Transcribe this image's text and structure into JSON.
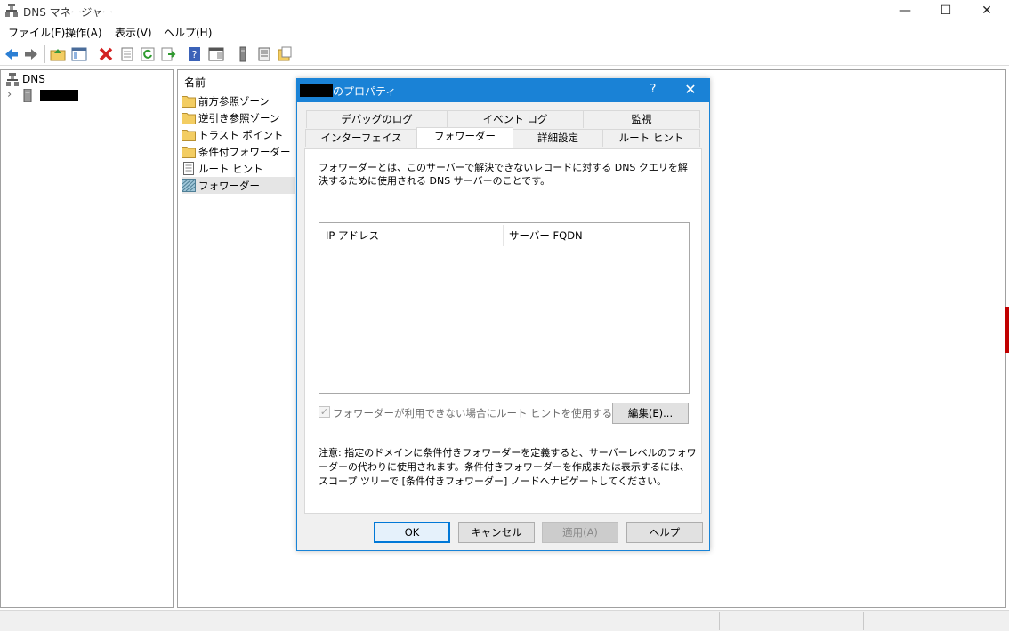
{
  "window": {
    "title": "DNS マネージャー",
    "controls": {
      "minimize": "—",
      "maximize": "☐",
      "close": "✕"
    }
  },
  "menu": {
    "items": [
      {
        "label": "ファイル(F)"
      },
      {
        "label": "操作(A)"
      },
      {
        "label": "表示(V)"
      },
      {
        "label": "ヘルプ(H)"
      }
    ]
  },
  "tree": {
    "root_label": "DNS",
    "expander": "›"
  },
  "list": {
    "header": "名前",
    "items": [
      {
        "label": "前方参照ゾーン",
        "icon": "folder-icon"
      },
      {
        "label": "逆引き参照ゾーン",
        "icon": "folder-icon"
      },
      {
        "label": "トラスト ポイント",
        "icon": "folder-icon"
      },
      {
        "label": "条件付フォワーダー",
        "icon": "folder-icon"
      },
      {
        "label": "ルート ヒント",
        "icon": "document-icon"
      },
      {
        "label": "フォワーダー",
        "icon": "forwarder-icon"
      }
    ]
  },
  "dialog": {
    "title_suffix": "のプロパティ",
    "help_glyph": "?",
    "close_glyph": "✕",
    "tabs_row1": [
      {
        "label": "デバッグのログ"
      },
      {
        "label": "イベント ログ"
      },
      {
        "label": "監視"
      }
    ],
    "tabs_row2": [
      {
        "label": "インターフェイス"
      },
      {
        "label": "フォワーダー"
      },
      {
        "label": "詳細設定"
      },
      {
        "label": "ルート ヒント"
      }
    ],
    "active_tab": "フォワーダー",
    "description": "フォワーダーとは、このサーバーで解決できないレコードに対する DNS クエリを解決するために使用される DNS サーバーのことです。",
    "table": {
      "columns": [
        "IP アドレス",
        "サーバー FQDN"
      ]
    },
    "checkbox": {
      "label": "フォワーダーが利用できない場合にルート ヒントを使用する",
      "checked": true,
      "mark": "✓"
    },
    "edit_button": "編集(E)...",
    "note": "注意: 指定のドメインに条件付きフォワーダーを定義すると、サーバーレベルのフォワーダーの代わりに使用されます。条件付きフォワーダーを作成または表示するには、スコープ ツリーで [条件付きフォワーダー] ノードへナビゲートしてください。",
    "buttons": {
      "ok": "OK",
      "cancel": "キャンセル",
      "apply": "適用(A)",
      "help": "ヘルプ"
    }
  },
  "colors": {
    "dialog_title": "#1a82d6",
    "folder": "#f3cd62",
    "default_button_border": "#0078d7"
  }
}
